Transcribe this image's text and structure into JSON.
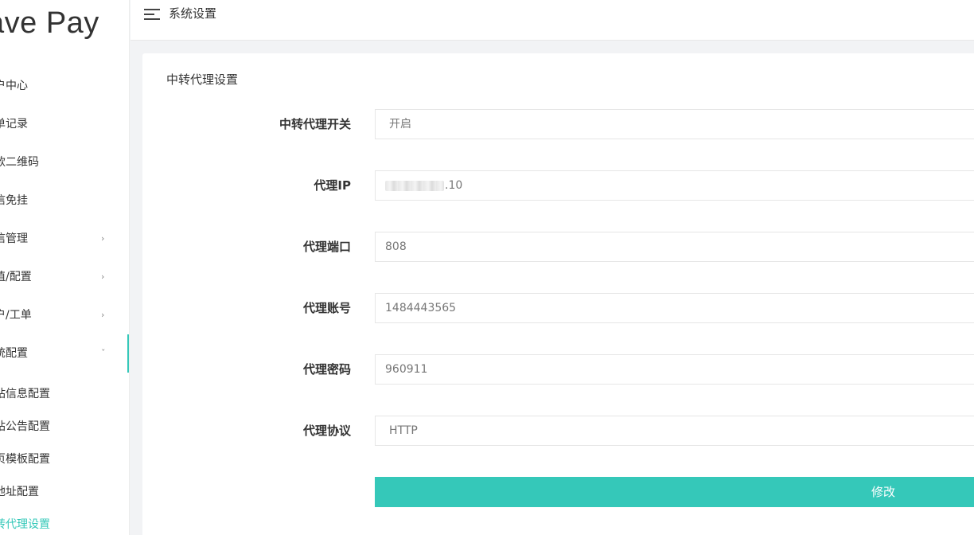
{
  "sidebar": {
    "logo": "ave Pay",
    "menu": [
      {
        "label": "户中心",
        "chevron": ""
      },
      {
        "label": "单记录",
        "chevron": ""
      },
      {
        "label": "款二维码",
        "chevron": ""
      },
      {
        "label": "信免挂",
        "chevron": ""
      },
      {
        "label": "信管理",
        "chevron": "›"
      },
      {
        "label": "值/配置",
        "chevron": "›"
      },
      {
        "label": "户/工单",
        "chevron": "›"
      },
      {
        "label": "统配置",
        "chevron": "ˇ"
      }
    ],
    "submenu": [
      {
        "label": "站信息配置"
      },
      {
        "label": "站公告配置"
      },
      {
        "label": "页模板配置"
      },
      {
        "label": "地址配置"
      },
      {
        "label": "转代理设置"
      }
    ]
  },
  "header": {
    "title": "系统设置"
  },
  "card": {
    "title": "中转代理设置",
    "fields": [
      {
        "label": "中转代理开关",
        "value": "开启"
      },
      {
        "label": "代理IP",
        "value": ".10"
      },
      {
        "label": "代理端口",
        "value": "808"
      },
      {
        "label": "代理账号",
        "value": "1484443565"
      },
      {
        "label": "代理密码",
        "value": "960911"
      },
      {
        "label": "代理协议",
        "value": "HTTP"
      }
    ],
    "submit_label": "修改"
  },
  "colors": {
    "accent": "#35c8b9",
    "background": "#f2f3f5"
  }
}
